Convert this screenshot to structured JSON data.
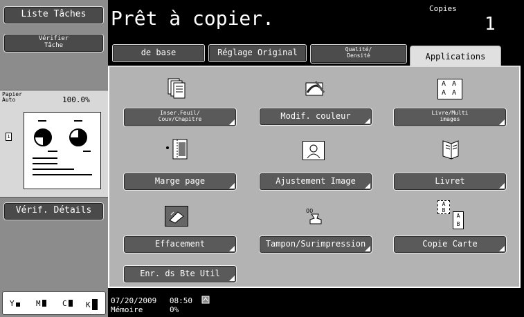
{
  "sidebar": {
    "task_list": "Liste Tâches",
    "verify_task_line1": "Vérifier",
    "verify_task_line2": "Tâche",
    "paper_line1": "Papier",
    "paper_line2": "Auto",
    "zoom": "100.0%",
    "page_number": "1",
    "verify_details": "Vérif. Détails",
    "toner": [
      "Y",
      "M",
      "C",
      "K"
    ]
  },
  "header": {
    "title": "Prêt à copier.",
    "copies_label": "Copies",
    "copies_count": "1"
  },
  "tabs": {
    "basic": "de base",
    "original": "Réglage Original",
    "quality_line1": "Qualité/",
    "quality_line2": "Densité",
    "applications": "Applications"
  },
  "functions": {
    "insert_line1": "Inser.Feuil/",
    "insert_line2": "Couv/Chapitre",
    "modify_color": "Modif. couleur",
    "book_line1": "Livre/Multi",
    "book_line2": "images",
    "page_margin": "Marge page",
    "image_adjust": "Ajustement Image",
    "booklet": "Livret",
    "erase": "Effacement",
    "stamp": "Tampon/Surimpression",
    "card_copy": "Copie Carte",
    "save_box": "Enr. ds Bte Util"
  },
  "icons": {
    "book_letters": [
      "A",
      "A",
      "A",
      "A"
    ],
    "card_letters": [
      "A",
      "B",
      "A",
      "B"
    ]
  },
  "status": {
    "date": "07/20/2009",
    "time": "08:50",
    "memory_label": "Mémoire",
    "memory_value": "0%"
  }
}
